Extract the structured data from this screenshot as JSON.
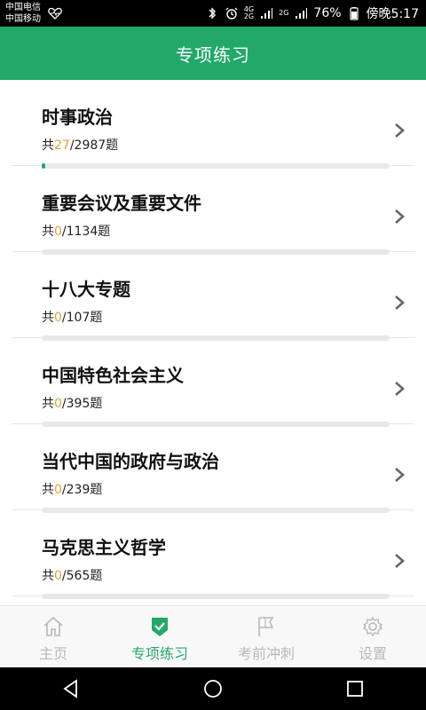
{
  "status_bar": {
    "carrier_1": "中国电信",
    "carrier_2": "中国移动",
    "network_1": "4G",
    "network_2": "2G",
    "network_3": "2G",
    "battery": "76%",
    "time": "傍晚5:17"
  },
  "header": {
    "title": "专项练习"
  },
  "topics": [
    {
      "title": "时事政治",
      "prefix": "共",
      "done": "27",
      "total": "/2987题",
      "progress": 0.009
    },
    {
      "title": "重要会议及重要文件",
      "prefix": "共",
      "done": "0",
      "total": "/1134题",
      "progress": 0
    },
    {
      "title": "十八大专题",
      "prefix": "共",
      "done": "0",
      "total": "/107题",
      "progress": 0
    },
    {
      "title": "中国特色社会主义",
      "prefix": "共",
      "done": "0",
      "total": "/395题",
      "progress": 0
    },
    {
      "title": "当代中国的政府与政治",
      "prefix": "共",
      "done": "0",
      "total": "/239题",
      "progress": 0
    },
    {
      "title": "马克思主义哲学",
      "prefix": "共",
      "done": "0",
      "total": "/565题",
      "progress": 0
    }
  ],
  "tabs": [
    {
      "label": "主页",
      "icon": "home-icon"
    },
    {
      "label": "专项练习",
      "icon": "shield-check-icon",
      "active": true
    },
    {
      "label": "考前冲刺",
      "icon": "flag-icon"
    },
    {
      "label": "设置",
      "icon": "gear-icon"
    }
  ],
  "colors": {
    "primary": "#23a86a",
    "done_count": "#d9a53a",
    "inactive_tab": "#b8b8b8"
  }
}
